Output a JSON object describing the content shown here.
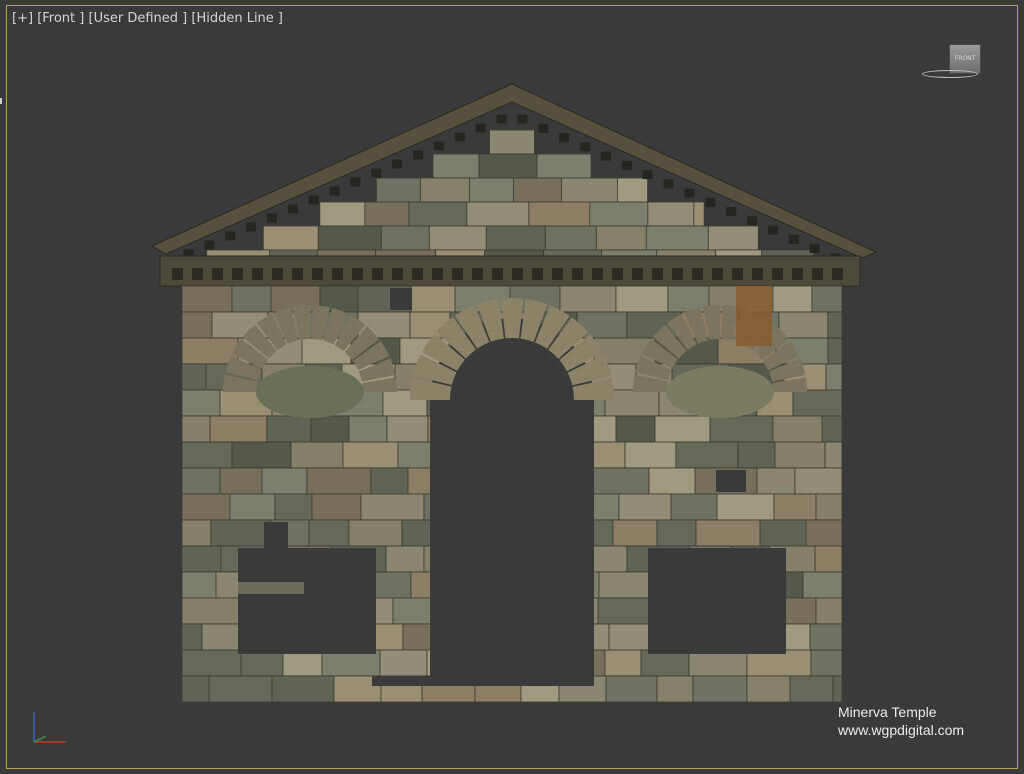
{
  "viewport": {
    "label_parts": [
      "[+]",
      "[Front ]",
      "[User Defined ]",
      "[Hidden Line ]"
    ],
    "background_color": "#3a3a3a",
    "border_color": "#b6a05a"
  },
  "viewcube": {
    "face_label": "FRONT"
  },
  "watermark": {
    "line1": "Minerva Temple",
    "line2": "www.wgpdigital.com"
  },
  "axis_tripod": {
    "x_color": "#c0392b",
    "y_color": "#2f9e44",
    "z_color": "#3a5fd0"
  },
  "model": {
    "stone_colors": [
      "#7d7f6e",
      "#8a8671",
      "#6f7262",
      "#938c76",
      "#5f6456",
      "#a09a80",
      "#776f5b",
      "#8e7e66",
      "#66695a",
      "#9a8f72",
      "#55594c",
      "#86806a"
    ],
    "accent_colors": [
      "#8a5a2c",
      "#6f4a2a"
    ]
  }
}
